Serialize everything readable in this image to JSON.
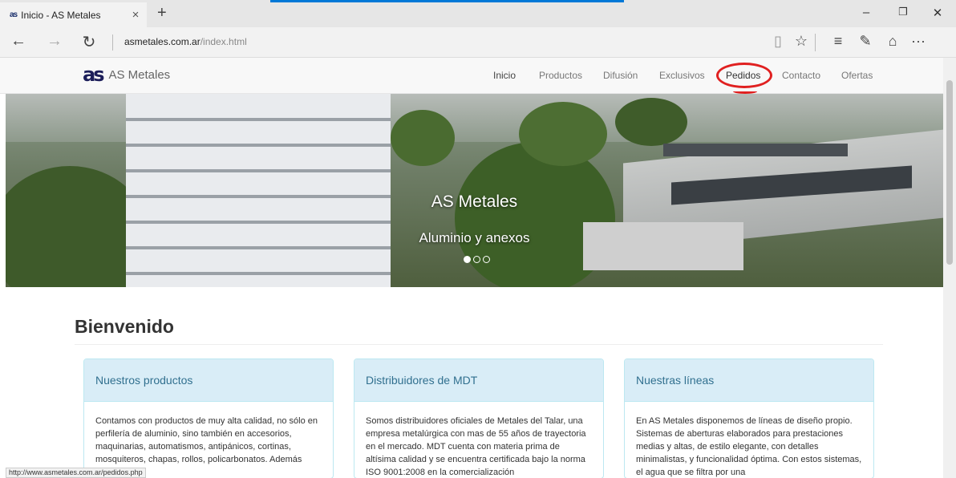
{
  "browser": {
    "tab": {
      "favicon": "as",
      "title": "Inicio - AS Metales",
      "close": "×"
    },
    "new_tab": "+",
    "window_controls": {
      "minimize": "–",
      "restore": "❐",
      "close": "✕"
    },
    "nav": {
      "back": "←",
      "forward": "→",
      "refresh": "↻"
    },
    "url": {
      "domain": "asmetales.com.ar",
      "path": "/index.html"
    },
    "toolbar_icons": [
      "reading-view-icon",
      "favorite-star-icon",
      "hub-icon",
      "web-note-icon",
      "share-icon",
      "more-icon"
    ],
    "toolbar_glyphs": {
      "reading": "▯",
      "star": "☆",
      "hub": "≡",
      "note": "✎",
      "share": "⌂",
      "more": "···"
    },
    "status_url": "http://www.asmetales.com.ar/pedidos.php",
    "accent_color": "#0078d7"
  },
  "site": {
    "brand": {
      "logo": "as",
      "name": "AS Metales"
    },
    "nav": [
      {
        "label": "Inicio",
        "active": true
      },
      {
        "label": "Productos",
        "active": false
      },
      {
        "label": "Difusión",
        "active": false
      },
      {
        "label": "Exclusivos",
        "active": false
      },
      {
        "label": "Pedidos",
        "active": false,
        "highlighted": true
      },
      {
        "label": "Contacto",
        "active": false
      },
      {
        "label": "Ofertas",
        "active": false
      }
    ],
    "hero": {
      "title": "AS Metales",
      "subtitle": "Aluminio y anexos",
      "slides": 3,
      "active_slide": 1
    },
    "welcome": "Bienvenido",
    "panels": [
      {
        "title": "Nuestros productos",
        "body": "Contamos con productos de muy alta calidad, no sólo en perfilería de aluminio, sino también en accesorios, maquinarias, automatismos, antipánicos, cortinas, mosquiteros, chapas, rollos, policarbonatos. Además contamos"
      },
      {
        "title": "Distribuidores de MDT",
        "body": "Somos distribuidores oficiales de Metales del Talar, una empresa metalúrgica con mas de 55 años de trayectoria en el mercado. MDT cuenta con materia prima de altísima calidad y se encuentra certificada bajo la norma ISO 9001:2008 en la comercialización"
      },
      {
        "title": "Nuestras líneas",
        "body": "En AS Metales disponemos de líneas de diseño propio. Sistemas de aberturas elaborados para prestaciones medias y altas, de estilo elegante, con detalles minimalistas, y funcionalidad óptima. Con estos sistemas, el agua que se filtra por una"
      }
    ],
    "colors": {
      "panel_header_bg": "#d9edf7",
      "panel_header_text": "#31708f",
      "highlight_circle": "#e02020",
      "brand_logo": "#1c1e5a"
    }
  }
}
